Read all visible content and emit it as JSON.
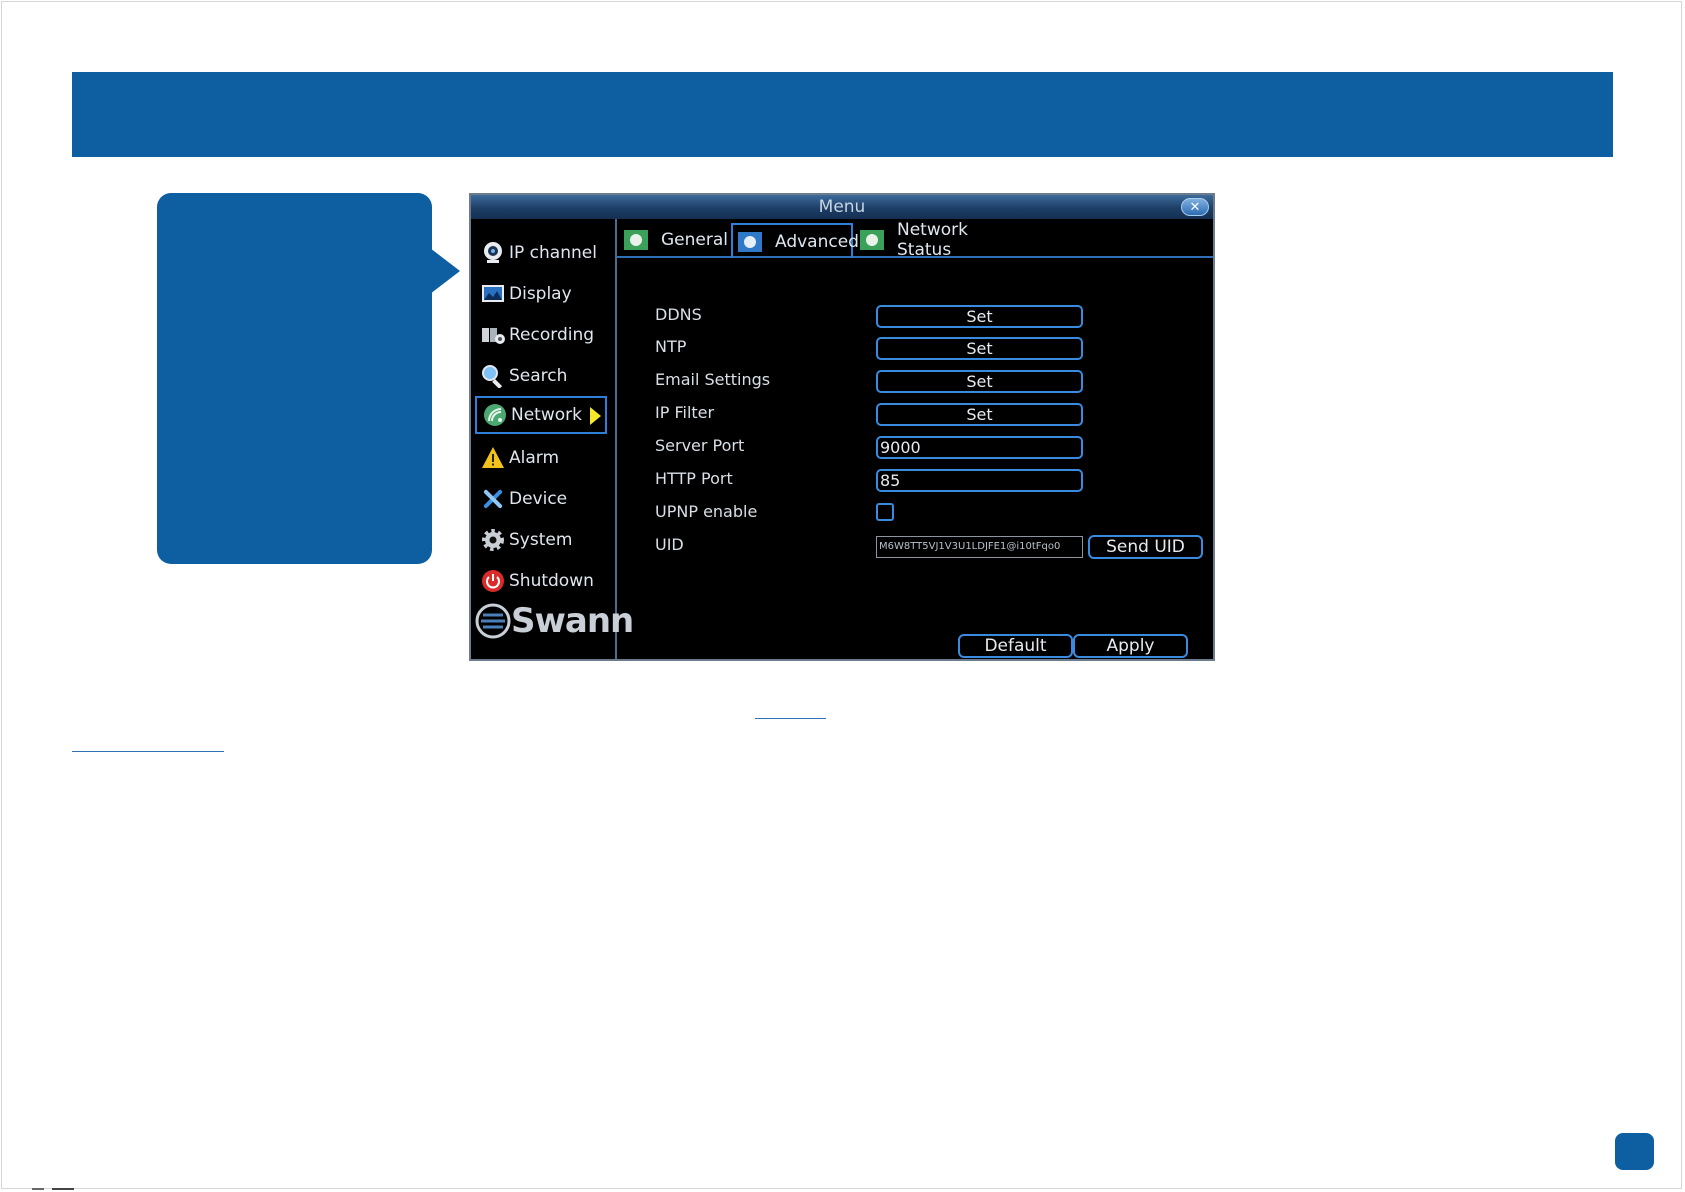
{
  "window": {
    "title": "Menu"
  },
  "sidebar": {
    "items": [
      {
        "label": "IP channel",
        "icon": "webcam-icon"
      },
      {
        "label": "Display",
        "icon": "display-icon"
      },
      {
        "label": "Recording",
        "icon": "recording-icon"
      },
      {
        "label": "Search",
        "icon": "magnifier-icon"
      },
      {
        "label": "Network",
        "icon": "network-icon",
        "active": true
      },
      {
        "label": "Alarm",
        "icon": "warning-icon"
      },
      {
        "label": "Device",
        "icon": "tools-icon"
      },
      {
        "label": "System",
        "icon": "gear-icon"
      },
      {
        "label": "Shutdown",
        "icon": "power-icon"
      }
    ],
    "logo": "Swann"
  },
  "tabs": [
    {
      "label": "General"
    },
    {
      "label": "Advanced",
      "active": true
    },
    {
      "label": "Network Status"
    }
  ],
  "form": {
    "ddns": {
      "label": "DDNS",
      "button": "Set"
    },
    "ntp": {
      "label": "NTP",
      "button": "Set"
    },
    "email": {
      "label": "Email Settings",
      "button": "Set"
    },
    "ip_filter": {
      "label": "IP Filter",
      "button": "Set"
    },
    "server_port": {
      "label": "Server Port",
      "value": "9000"
    },
    "http_port": {
      "label": "HTTP Port",
      "value": "85"
    },
    "upnp": {
      "label": "UPNP enable",
      "checked": false
    },
    "uid": {
      "label": "UID",
      "value": "M6W8TT5VJ1V3U1LDJFE1@i10tFqo0",
      "send_button": "Send UID"
    }
  },
  "footer": {
    "default_button": "Default",
    "apply_button": "Apply"
  },
  "colors": {
    "brand_blue": "#0e5fa1",
    "highlight_border": "#3a8ae0",
    "menu_arrow": "#f6e82a"
  }
}
